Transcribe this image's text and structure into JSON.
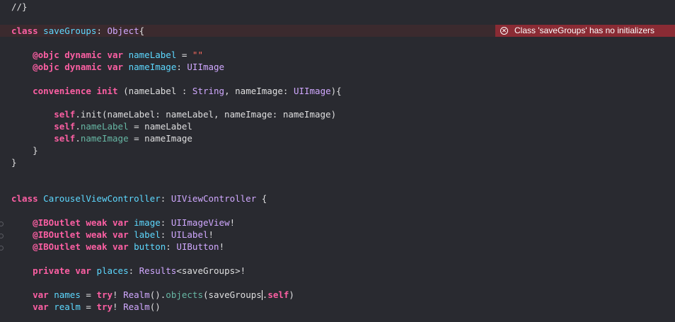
{
  "code": {
    "comment_top": "//}",
    "kw_class": "class",
    "kw_dynamic": "dynamic",
    "kw_var": "var",
    "kw_convenience": "convenience",
    "kw_init": "init",
    "kw_self": "self",
    "kw_weak": "weak",
    "kw_private": "private",
    "kw_try": "try",
    "attr_objc": "@objc",
    "attr_iboutlet": "@IBOutlet",
    "class1_name": "saveGroups",
    "class1_super": "Object",
    "prop_nameLabel": "nameLabel",
    "prop_nameImage": "nameImage",
    "str_empty": "\"\"",
    "type_UIImage": "UIImage",
    "type_String": "String",
    "init_call": "init(nameLabel: nameLabel, nameImage: nameImage)",
    "class2_name": "CarouselViewController",
    "class2_super": "UIViewController",
    "prop_image": "image",
    "type_UIImageView": "UIImageView",
    "prop_label": "label",
    "type_UILabel": "UILabel",
    "prop_button": "button",
    "type_UIButton": "UIButton",
    "prop_places": "places",
    "type_Results": "Results",
    "prop_names": "names",
    "func_Realm": "Realm",
    "func_objects": "objects",
    "prop_realm": "realm"
  },
  "error": {
    "message": "Class 'saveGroups' has no initializers",
    "icon": "error-circle-x-icon",
    "color": "#8a2b34"
  },
  "colors": {
    "background": "#292a30",
    "keyword": "#fc5fa3",
    "string": "#fc6a5d",
    "type": "#d0a8ff",
    "declared_type": "#5dd8ff",
    "property": "#67b7a4"
  }
}
